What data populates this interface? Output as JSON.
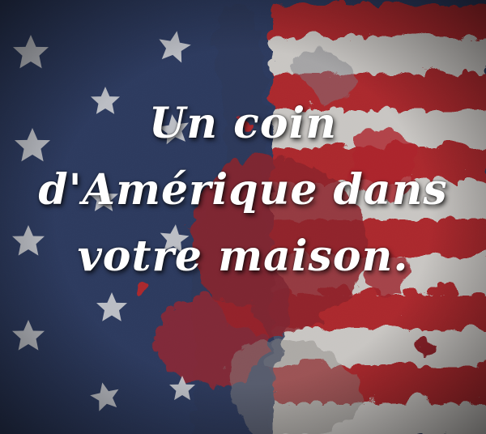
{
  "headline": {
    "lines": [
      "Un coin",
      "d'Amérique dans",
      "votre maison."
    ]
  },
  "flag": {
    "colors": {
      "canton_blue": "#1f3366",
      "deep_blue": "#141f3f",
      "stripe_red": "#b5121b",
      "paint_red": "#8f0d14",
      "stripe_white": "#d9d6d2",
      "star_white": "#e8e8ea"
    },
    "icons": [
      "star-icon",
      "paint-splatter"
    ]
  }
}
